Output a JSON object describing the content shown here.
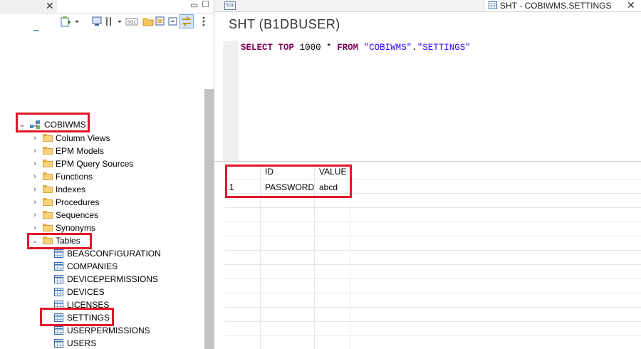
{
  "left": {
    "close_glyph": "✕",
    "min_glyph": "▭",
    "max_glyph": "☐",
    "schema": {
      "label": "COBIWMS"
    },
    "folders": [
      {
        "label": "Column Views"
      },
      {
        "label": "EPM Models"
      },
      {
        "label": "EPM Query Sources"
      },
      {
        "label": "Functions"
      },
      {
        "label": "Indexes"
      },
      {
        "label": "Procedures"
      },
      {
        "label": "Sequences"
      },
      {
        "label": "Synonyms"
      },
      {
        "label": "Tables"
      }
    ],
    "tables": [
      {
        "label": "BEASCONFIGURATION"
      },
      {
        "label": "COMPANIES"
      },
      {
        "label": "DEVICEPERMISSIONS"
      },
      {
        "label": "DEVICES"
      },
      {
        "label": "LICENSES"
      },
      {
        "label": "SETTINGS"
      },
      {
        "label": "USERPERMISSIONS"
      },
      {
        "label": "USERS"
      }
    ]
  },
  "editor": {
    "sql_tab_icon": "SQL",
    "active_tab_label": "SHT - COBIWMS.SETTINGS",
    "active_tab_close": "✕",
    "title": "SHT (B1DBUSER)",
    "query": {
      "select": "SELECT",
      "top": "TOP",
      "num": "1000",
      "star": "*",
      "from": "FROM",
      "schema": "\"COBIWMS\"",
      "dot": ".",
      "table": "\"SETTINGS\""
    }
  },
  "results": {
    "columns": [
      "ID",
      "VALUE"
    ],
    "rows": [
      {
        "num": "1",
        "ID": "PASSWORD",
        "VALUE": "abcd"
      }
    ]
  },
  "colors": {
    "highlight": "#e0162b",
    "keyword": "#7f0055",
    "string": "#2a00ff"
  }
}
